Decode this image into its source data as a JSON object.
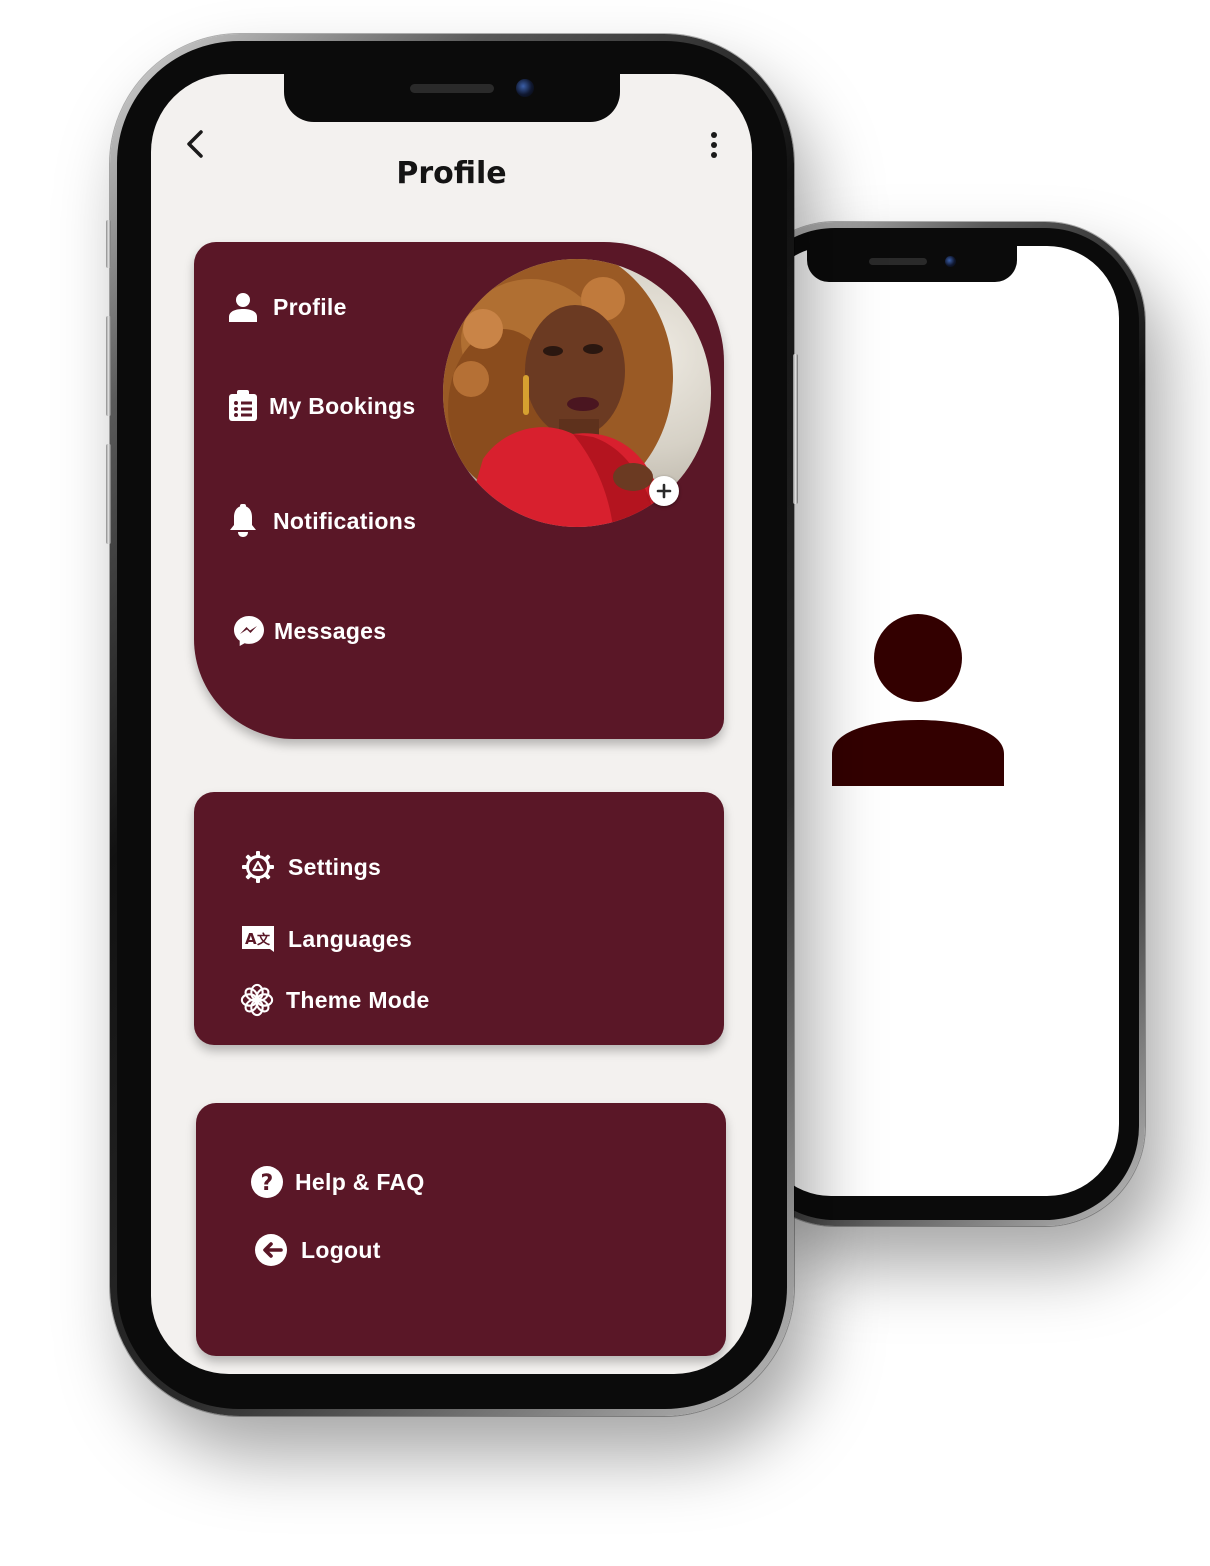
{
  "header": {
    "title": "Profile"
  },
  "account_menu": [
    {
      "label": "Profile",
      "icon": "person-icon"
    },
    {
      "label": "My Bookings",
      "icon": "clipboard-list-icon"
    },
    {
      "label": "Notifications",
      "icon": "bell-icon"
    },
    {
      "label": "Messages",
      "icon": "messenger-icon"
    }
  ],
  "preferences_menu": [
    {
      "label": "Settings",
      "icon": "gear-icon"
    },
    {
      "label": "Languages",
      "icon": "translate-icon"
    },
    {
      "label": "Theme Mode",
      "icon": "theme-flower-icon"
    }
  ],
  "support_menu": [
    {
      "label": "Help & FAQ",
      "icon": "help-circle-icon"
    },
    {
      "label": "Logout",
      "icon": "logout-icon"
    }
  ],
  "avatar": {
    "description_icon": "profile-photo",
    "add_button_icon": "plus-icon"
  },
  "back_screen": {
    "placeholder_icon": "user-silhouette-icon"
  },
  "colors": {
    "card_background": "#5a1727",
    "screen_background": "#f3f1ef",
    "placeholder_icon": "#330000",
    "text_on_card": "#ffffff",
    "title_text": "#141414"
  }
}
